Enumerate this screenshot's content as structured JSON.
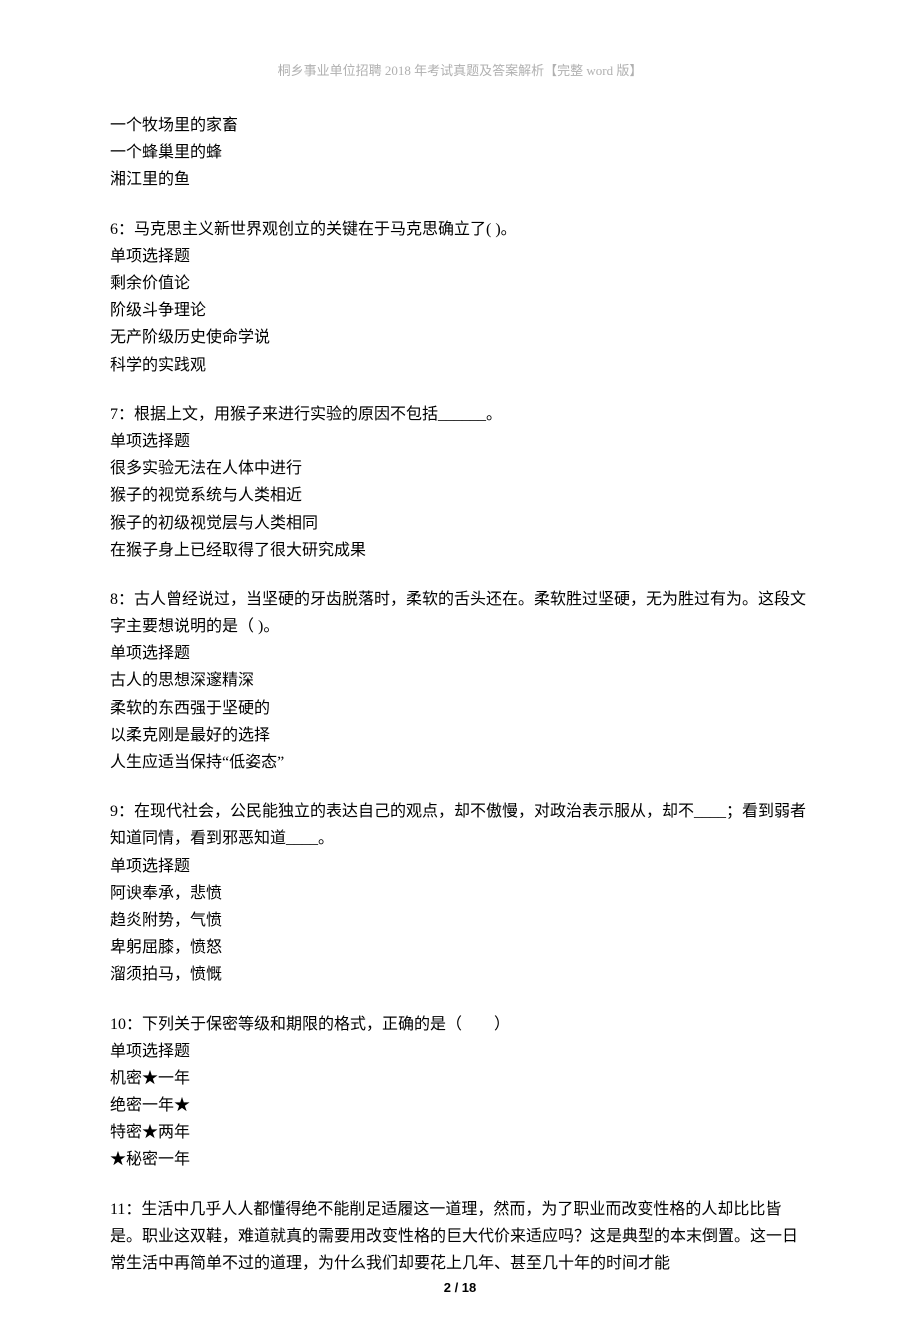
{
  "header": "桐乡事业单位招聘 2018 年考试真题及答案解析【完整 word 版】",
  "footer": "2 / 18",
  "intro_lines": [
    "一个牧场里的家畜",
    "一个蜂巢里的蜂",
    "湘江里的鱼"
  ],
  "questions": [
    {
      "stem": "6：马克思主义新世界观创立的关键在于马克思确立了( )。",
      "type": "单项选择题",
      "options": [
        "剩余价值论",
        "阶级斗争理论",
        "无产阶级历史使命学说",
        "科学的实践观"
      ]
    },
    {
      "stem": "7：根据上文，用猴子来进行实验的原因不包括______。",
      "type": "单项选择题",
      "options": [
        "很多实验无法在人体中进行",
        "猴子的视觉系统与人类相近",
        "猴子的初级视觉层与人类相同",
        "在猴子身上已经取得了很大研究成果"
      ]
    },
    {
      "stem": "8：古人曾经说过，当坚硬的牙齿脱落时，柔软的舌头还在。柔软胜过坚硬，无为胜过有为。这段文字主要想说明的是（ )。",
      "type": "单项选择题",
      "options": [
        "古人的思想深邃精深",
        "柔软的东西强于坚硬的",
        "以柔克刚是最好的选择",
        "人生应适当保持“低姿态”"
      ]
    },
    {
      "stem": "9：在现代社会，公民能独立的表达自己的观点，却不傲慢，对政治表示服从，却不____；看到弱者知道同情，看到邪恶知道____。",
      "type": "单项选择题",
      "options": [
        "阿谀奉承，悲愤",
        "趋炎附势，气愤",
        "卑躬屈膝，愤怒",
        "溜须拍马，愤慨"
      ]
    },
    {
      "stem": "10：下列关于保密等级和期限的格式，正确的是（　　）",
      "type": "单项选择题",
      "options": [
        "机密★一年",
        "绝密一年★",
        "特密★两年",
        "★秘密一年"
      ]
    },
    {
      "stem": "11：生活中几乎人人都懂得绝不能削足适履这一道理，然而，为了职业而改变性格的人却比比皆是。职业这双鞋，难道就真的需要用改变性格的巨大代价来适应吗？这是典型的本末倒置。这一日常生活中再简单不过的道理，为什么我们却要花上几年、甚至几十年的时间才能",
      "type": "",
      "options": []
    }
  ]
}
